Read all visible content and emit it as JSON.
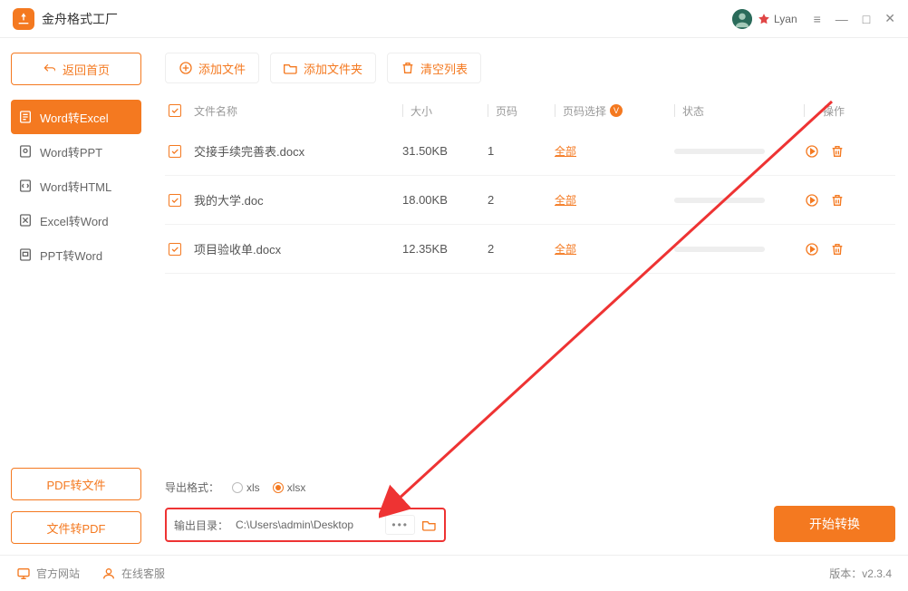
{
  "app": {
    "title": "金舟格式工厂",
    "username": "Lyan"
  },
  "sidebar": {
    "back": "返回首页",
    "items": [
      {
        "label": "Word转Excel"
      },
      {
        "label": "Word转PPT"
      },
      {
        "label": "Word转HTML"
      },
      {
        "label": "Excel转Word"
      },
      {
        "label": "PPT转Word"
      }
    ],
    "pdf_to_file": "PDF转文件",
    "file_to_pdf": "文件转PDF"
  },
  "toolbar": {
    "add_file": "添加文件",
    "add_folder": "添加文件夹",
    "clear": "清空列表"
  },
  "table": {
    "headers": {
      "name": "文件名称",
      "size": "大小",
      "page": "页码",
      "select": "页码选择",
      "status": "状态",
      "ops": "操作"
    },
    "rows": [
      {
        "name": "交接手续完善表.docx",
        "size": "31.50KB",
        "page": "1",
        "select": "全部"
      },
      {
        "name": "我的大学.doc",
        "size": "18.00KB",
        "page": "2",
        "select": "全部"
      },
      {
        "name": "项目验收单.docx",
        "size": "12.35KB",
        "page": "2",
        "select": "全部"
      }
    ]
  },
  "bottom": {
    "format_label": "导出格式：",
    "xls": "xls",
    "xlsx": "xlsx",
    "output_label": "输出目录：",
    "output_path": "C:\\Users\\admin\\Desktop",
    "convert": "开始转换"
  },
  "footer": {
    "site": "官方网站",
    "support": "在线客服",
    "version_label": "版本：",
    "version": "v2.3.4"
  }
}
